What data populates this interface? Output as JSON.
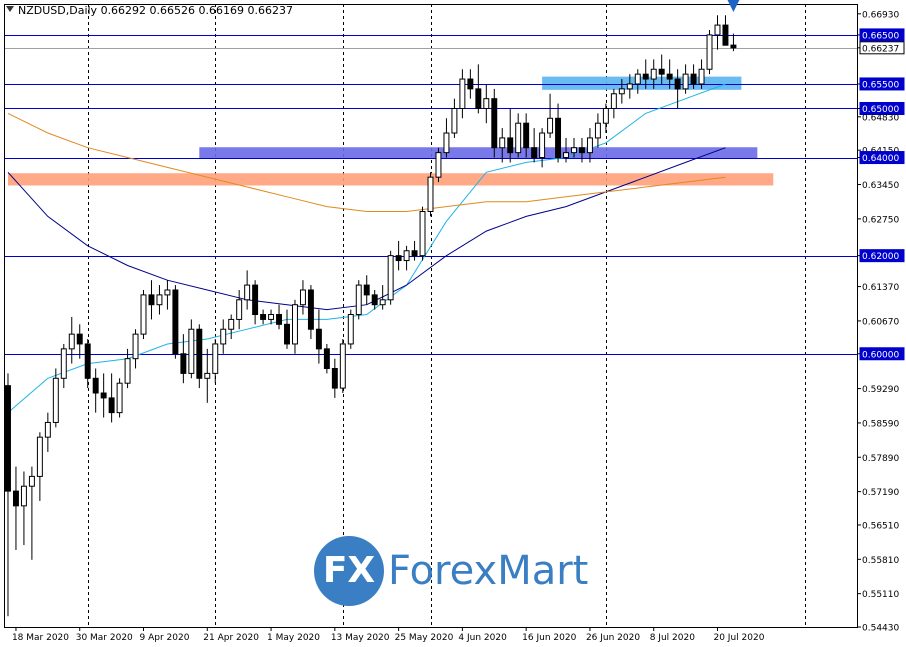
{
  "header": {
    "symbol_info": "NZDUSD,Daily  0.66292 0.66526 0.66169 0.66237"
  },
  "logo": {
    "mark": "FX",
    "name": "ForexMart"
  },
  "colors": {
    "background": "#ffffff",
    "grid": "#000000",
    "level_line": "#0000cd",
    "price_line": "#a0a0a0",
    "ma_fast": "#1eb4e6",
    "ma_mid": "#00008b",
    "ma_slow": "#e08a1e",
    "zone_blue": "#6a6ae8",
    "zone_light_blue": "#5ab4f0",
    "zone_orange": "#ffa07a",
    "marker": "#1e64c8"
  },
  "chart_data": {
    "type": "candlestick",
    "symbol": "NZDUSD",
    "timeframe": "Daily",
    "last_bar": {
      "open": 0.66292,
      "high": 0.66526,
      "low": 0.66169,
      "close": 0.66237
    },
    "ylim": [
      0.5443,
      0.6713
    ],
    "y_ticks": [
      "0.66930",
      "0.66500",
      "0.66237",
      "0.65500",
      "0.65000",
      "0.64830",
      "0.64150",
      "0.64000",
      "0.63450",
      "0.62750",
      "0.62000",
      "0.61370",
      "0.60670",
      "0.60000",
      "0.59290",
      "0.58590",
      "0.57890",
      "0.57190",
      "0.56510",
      "0.55810",
      "0.55110",
      "0.54430"
    ],
    "x_labels": [
      "18 Mar 2020",
      "30 Mar 2020",
      "9 Apr 2020",
      "21 Apr 2020",
      "1 May 2020",
      "13 May 2020",
      "25 May 2020",
      "4 Jun 2020",
      "16 Jun 2020",
      "26 Jun 2020",
      "8 Jul 2020",
      "20 Jul 2020"
    ],
    "x_label_bars": [
      1,
      9,
      17,
      25,
      33,
      41,
      49,
      57,
      65,
      73,
      81,
      89
    ],
    "x_bar_count": 107,
    "vertical_grid_bars": [
      10,
      26,
      42,
      53,
      75,
      100
    ],
    "levels": [
      {
        "value": 0.665,
        "label": "0.66500"
      },
      {
        "value": 0.655,
        "label": "0.65500"
      },
      {
        "value": 0.65,
        "label": "0.65000"
      },
      {
        "value": 0.64,
        "label": "0.64000"
      },
      {
        "value": 0.62,
        "label": "0.62000"
      },
      {
        "value": 0.6,
        "label": "0.60000"
      }
    ],
    "current_price": {
      "value": 0.66237,
      "label": "0.66237"
    },
    "zones": [
      {
        "name": "resistance-zone-0.656",
        "from_bar": 67,
        "to_bar": 92,
        "top": 0.6565,
        "bottom": 0.6538,
        "color": "zone_light_blue"
      },
      {
        "name": "support-zone-0.641",
        "from_bar": 24,
        "to_bar": 94,
        "top": 0.6421,
        "bottom": 0.6397,
        "color": "zone_blue"
      },
      {
        "name": "support-zone-0.635",
        "from_bar": 0,
        "to_bar": 96,
        "top": 0.6368,
        "bottom": 0.6343,
        "color": "zone_orange"
      }
    ],
    "sell_marker": {
      "bar": 91,
      "price": 0.6707
    },
    "series": [
      {
        "kind": "ohlc",
        "bars": [
          [
            0.5935,
            0.596,
            0.5465,
            0.572
          ],
          [
            0.572,
            0.577,
            0.56,
            0.569
          ],
          [
            0.569,
            0.576,
            0.561,
            0.573
          ],
          [
            0.573,
            0.577,
            0.558,
            0.575
          ],
          [
            0.575,
            0.584,
            0.57,
            0.583
          ],
          [
            0.583,
            0.588,
            0.58,
            0.586
          ],
          [
            0.586,
            0.597,
            0.585,
            0.595
          ],
          [
            0.595,
            0.602,
            0.593,
            0.601
          ],
          [
            0.601,
            0.6075,
            0.598,
            0.604
          ],
          [
            0.604,
            0.606,
            0.599,
            0.602
          ],
          [
            0.602,
            0.603,
            0.593,
            0.595
          ],
          [
            0.595,
            0.597,
            0.588,
            0.592
          ],
          [
            0.592,
            0.596,
            0.587,
            0.591
          ],
          [
            0.591,
            0.596,
            0.586,
            0.588
          ],
          [
            0.588,
            0.595,
            0.587,
            0.594
          ],
          [
            0.594,
            0.601,
            0.593,
            0.599
          ],
          [
            0.599,
            0.605,
            0.597,
            0.604
          ],
          [
            0.604,
            0.613,
            0.603,
            0.612
          ],
          [
            0.612,
            0.615,
            0.607,
            0.61
          ],
          [
            0.61,
            0.614,
            0.608,
            0.612
          ],
          [
            0.612,
            0.615,
            0.609,
            0.613
          ],
          [
            0.613,
            0.614,
            0.599,
            0.6
          ],
          [
            0.6,
            0.604,
            0.594,
            0.596
          ],
          [
            0.596,
            0.607,
            0.595,
            0.605
          ],
          [
            0.605,
            0.606,
            0.593,
            0.595
          ],
          [
            0.595,
            0.601,
            0.59,
            0.596
          ],
          [
            0.596,
            0.603,
            0.594,
            0.602
          ],
          [
            0.602,
            0.607,
            0.6,
            0.605
          ],
          [
            0.605,
            0.608,
            0.603,
            0.607
          ],
          [
            0.607,
            0.613,
            0.605,
            0.611
          ],
          [
            0.611,
            0.617,
            0.609,
            0.614
          ],
          [
            0.614,
            0.615,
            0.606,
            0.608
          ],
          [
            0.608,
            0.609,
            0.606,
            0.607
          ],
          [
            0.607,
            0.609,
            0.606,
            0.608
          ],
          [
            0.608,
            0.61,
            0.605,
            0.606
          ],
          [
            0.606,
            0.609,
            0.601,
            0.602
          ],
          [
            0.602,
            0.611,
            0.6,
            0.61
          ],
          [
            0.61,
            0.615,
            0.608,
            0.613
          ],
          [
            0.613,
            0.614,
            0.603,
            0.605
          ],
          [
            0.605,
            0.609,
            0.598,
            0.601
          ],
          [
            0.601,
            0.602,
            0.596,
            0.597
          ],
          [
            0.597,
            0.599,
            0.591,
            0.593
          ],
          [
            0.593,
            0.603,
            0.592,
            0.602
          ],
          [
            0.602,
            0.609,
            0.601,
            0.608
          ],
          [
            0.608,
            0.615,
            0.607,
            0.614
          ],
          [
            0.614,
            0.616,
            0.61,
            0.612
          ],
          [
            0.612,
            0.613,
            0.609,
            0.61
          ],
          [
            0.61,
            0.614,
            0.609,
            0.611
          ],
          [
            0.611,
            0.621,
            0.61,
            0.62
          ],
          [
            0.62,
            0.623,
            0.617,
            0.619
          ],
          [
            0.619,
            0.622,
            0.617,
            0.621
          ],
          [
            0.621,
            0.623,
            0.619,
            0.62
          ],
          [
            0.62,
            0.63,
            0.619,
            0.629
          ],
          [
            0.629,
            0.637,
            0.628,
            0.636
          ],
          [
            0.636,
            0.642,
            0.635,
            0.641
          ],
          [
            0.641,
            0.648,
            0.64,
            0.645
          ],
          [
            0.645,
            0.652,
            0.644,
            0.65
          ],
          [
            0.65,
            0.658,
            0.648,
            0.656
          ],
          [
            0.656,
            0.658,
            0.652,
            0.654
          ],
          [
            0.654,
            0.659,
            0.649,
            0.65
          ],
          [
            0.65,
            0.655,
            0.647,
            0.652
          ],
          [
            0.652,
            0.654,
            0.64,
            0.642
          ],
          [
            0.642,
            0.646,
            0.639,
            0.644
          ],
          [
            0.644,
            0.65,
            0.639,
            0.641
          ],
          [
            0.641,
            0.649,
            0.64,
            0.647
          ],
          [
            0.647,
            0.649,
            0.64,
            0.642
          ],
          [
            0.642,
            0.646,
            0.639,
            0.64
          ],
          [
            0.64,
            0.646,
            0.638,
            0.645
          ],
          [
            0.645,
            0.653,
            0.644,
            0.648
          ],
          [
            0.648,
            0.651,
            0.639,
            0.64
          ],
          [
            0.64,
            0.644,
            0.639,
            0.641
          ],
          [
            0.641,
            0.644,
            0.64,
            0.642
          ],
          [
            0.642,
            0.644,
            0.639,
            0.641
          ],
          [
            0.641,
            0.646,
            0.639,
            0.644
          ],
          [
            0.644,
            0.649,
            0.642,
            0.647
          ],
          [
            0.647,
            0.651,
            0.645,
            0.65
          ],
          [
            0.65,
            0.654,
            0.648,
            0.653
          ],
          [
            0.653,
            0.656,
            0.651,
            0.654
          ],
          [
            0.654,
            0.657,
            0.652,
            0.655
          ],
          [
            0.655,
            0.658,
            0.653,
            0.657
          ],
          [
            0.657,
            0.66,
            0.654,
            0.656
          ],
          [
            0.656,
            0.66,
            0.654,
            0.658
          ],
          [
            0.658,
            0.661,
            0.655,
            0.657
          ],
          [
            0.657,
            0.66,
            0.654,
            0.656
          ],
          [
            0.656,
            0.658,
            0.65,
            0.654
          ],
          [
            0.654,
            0.659,
            0.653,
            0.657
          ],
          [
            0.657,
            0.659,
            0.654,
            0.655
          ],
          [
            0.655,
            0.66,
            0.654,
            0.658
          ],
          [
            0.658,
            0.666,
            0.657,
            0.665
          ],
          [
            0.665,
            0.669,
            0.662,
            0.667
          ],
          [
            0.667,
            0.669,
            0.663,
            0.6629
          ],
          [
            0.66292,
            0.66526,
            0.66169,
            0.66237
          ]
        ]
      },
      {
        "name": "",
        "kind": "ma",
        "color": "ma_fast",
        "points": [
          [
            0,
            0.588
          ],
          [
            5,
            0.595
          ],
          [
            10,
            0.598
          ],
          [
            15,
            0.599
          ],
          [
            20,
            0.602
          ],
          [
            25,
            0.603
          ],
          [
            30,
            0.605
          ],
          [
            35,
            0.607
          ],
          [
            40,
            0.607
          ],
          [
            45,
            0.608
          ],
          [
            50,
            0.614
          ],
          [
            55,
            0.627
          ],
          [
            60,
            0.637
          ],
          [
            65,
            0.639
          ],
          [
            70,
            0.64
          ],
          [
            75,
            0.643
          ],
          [
            80,
            0.649
          ],
          [
            85,
            0.652
          ],
          [
            90,
            0.655
          ]
        ]
      },
      {
        "name": "",
        "kind": "ma",
        "color": "ma_mid",
        "points": [
          [
            0,
            0.637
          ],
          [
            5,
            0.628
          ],
          [
            10,
            0.622
          ],
          [
            15,
            0.618
          ],
          [
            20,
            0.615
          ],
          [
            25,
            0.613
          ],
          [
            30,
            0.611
          ],
          [
            35,
            0.61
          ],
          [
            40,
            0.609
          ],
          [
            45,
            0.61
          ],
          [
            50,
            0.614
          ],
          [
            55,
            0.62
          ],
          [
            60,
            0.625
          ],
          [
            65,
            0.628
          ],
          [
            70,
            0.63
          ],
          [
            75,
            0.633
          ],
          [
            80,
            0.636
          ],
          [
            85,
            0.639
          ],
          [
            90,
            0.642
          ]
        ]
      },
      {
        "name": "",
        "kind": "ma",
        "color": "ma_slow",
        "points": [
          [
            0,
            0.649
          ],
          [
            5,
            0.645
          ],
          [
            10,
            0.642
          ],
          [
            15,
            0.64
          ],
          [
            20,
            0.638
          ],
          [
            25,
            0.636
          ],
          [
            30,
            0.634
          ],
          [
            35,
            0.632
          ],
          [
            40,
            0.63
          ],
          [
            45,
            0.629
          ],
          [
            50,
            0.629
          ],
          [
            55,
            0.63
          ],
          [
            60,
            0.631
          ],
          [
            65,
            0.631
          ],
          [
            70,
            0.632
          ],
          [
            75,
            0.633
          ],
          [
            80,
            0.634
          ],
          [
            85,
            0.635
          ],
          [
            90,
            0.636
          ]
        ]
      }
    ]
  }
}
